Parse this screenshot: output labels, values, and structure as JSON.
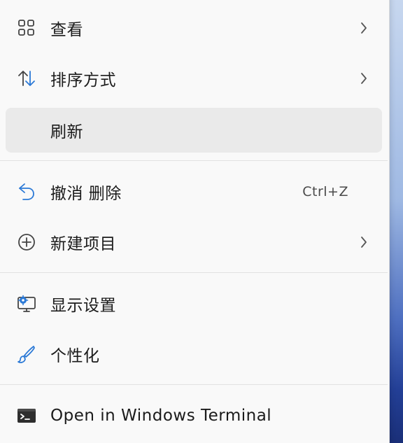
{
  "context_menu": {
    "items": [
      {
        "label": "查看",
        "icon": "grid-icon",
        "has_submenu": true
      },
      {
        "label": "排序方式",
        "icon": "sort-icon",
        "has_submenu": true
      },
      {
        "label": "刷新",
        "icon": "",
        "has_submenu": false
      },
      {
        "label": "撤消 删除",
        "icon": "undo-icon",
        "shortcut": "Ctrl+Z",
        "has_submenu": false
      },
      {
        "label": "新建项目",
        "icon": "add-circle-icon",
        "has_submenu": true
      },
      {
        "label": "显示设置",
        "icon": "display-settings-icon",
        "has_submenu": false
      },
      {
        "label": "个性化",
        "icon": "brush-icon",
        "has_submenu": false
      },
      {
        "label": "Open in Windows Terminal",
        "icon": "terminal-icon",
        "has_submenu": false
      }
    ]
  },
  "colors": {
    "menu_background": "#f9f9f9",
    "hover_background": "#eaeaea",
    "accent_blue": "#2b79d6",
    "text": "#1b1b1b"
  }
}
